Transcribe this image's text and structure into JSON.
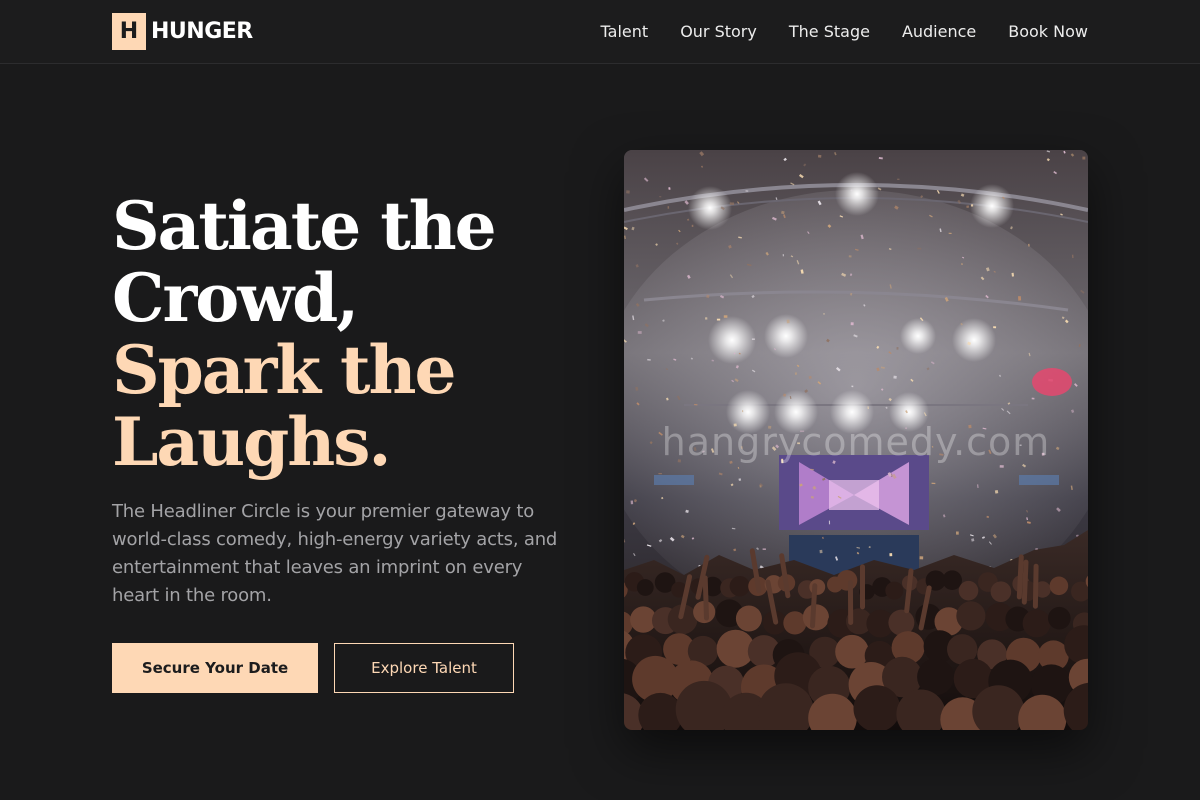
{
  "brand": {
    "mark": "H",
    "name": "HUNGER",
    "accent_color": "#fed8b5",
    "background_color": "#1a1a1b"
  },
  "nav": {
    "items": [
      "Talent",
      "Our Story",
      "The Stage",
      "Audience",
      "Book Now"
    ]
  },
  "hero": {
    "headline_line1": "Satiate the",
    "headline_line2": "Crowd,",
    "headline_line3": "Spark the",
    "headline_line4": "Laughs.",
    "description": "The Headliner Circle is your premier gateway to world-class comedy, high-energy variety acts, and entertainment that leaves an imprint on every heart in the room.",
    "primary_button": "Secure Your Date",
    "secondary_button": "Explore Talent"
  },
  "image": {
    "subject": "concert-crowd-stage-lights-confetti",
    "watermark": "hangrycomedy.com"
  }
}
